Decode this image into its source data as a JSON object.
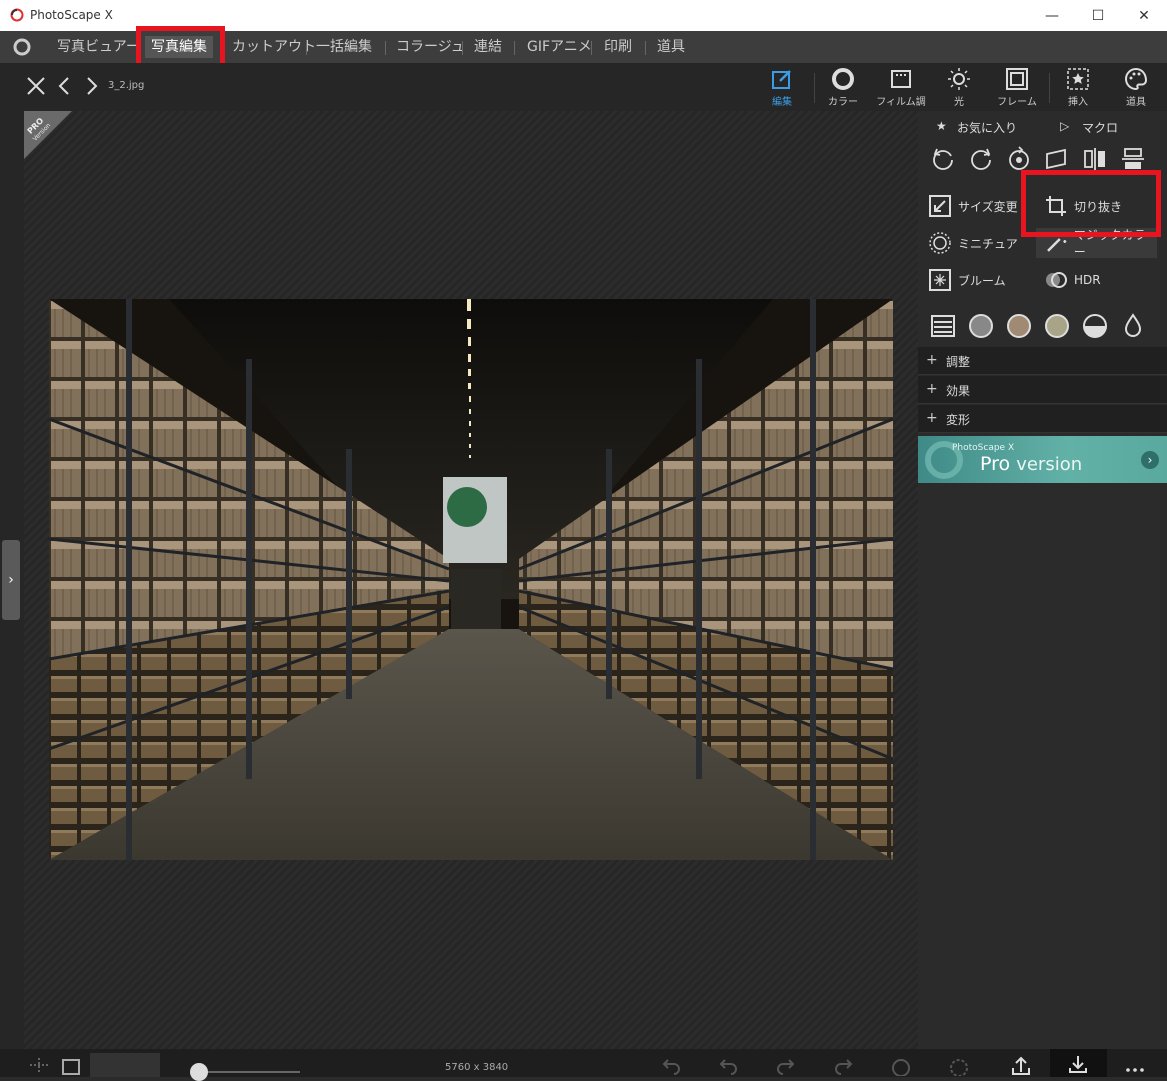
{
  "window": {
    "title": "PhotoScape X",
    "minimize": "—",
    "maximize": "☐",
    "close": "✕"
  },
  "menu": {
    "items": [
      {
        "label": "写真ビュアー"
      },
      {
        "label": "写真編集"
      },
      {
        "label": "カットアウト"
      },
      {
        "label": "一括編集"
      },
      {
        "label": "コラージュ"
      },
      {
        "label": "連結"
      },
      {
        "label": "GIFアニメ"
      },
      {
        "label": "印刷"
      },
      {
        "label": "道具"
      }
    ],
    "active": "写真編集"
  },
  "toolbar": {
    "filename": "3_2.jpg",
    "tools": [
      {
        "label": "編集",
        "icon": "edit-icon",
        "active": true
      },
      {
        "label": "カラー",
        "icon": "color-circle-icon"
      },
      {
        "label": "フィルム調",
        "icon": "film-icon"
      },
      {
        "label": "光",
        "icon": "light-sun-icon"
      },
      {
        "label": "フレーム",
        "icon": "frame-icon"
      },
      {
        "label": "挿入",
        "icon": "insert-star-icon"
      },
      {
        "label": "道具",
        "icon": "palette-icon"
      }
    ]
  },
  "canvas": {
    "ribbon_top": "PRO",
    "ribbon_bottom": "Version"
  },
  "sidebar": {
    "favorites": "お気に入り",
    "macro": "マクロ",
    "functions": {
      "resize": "サイズ変更",
      "crop": "切り抜き",
      "miniature": "ミニチュア",
      "magic_color": "マジックカラー",
      "bloom": "ブルーム",
      "hdr": "HDR"
    },
    "sections": [
      "調整",
      "効果",
      "変形"
    ],
    "pro_banner": {
      "small": "PhotoScape X",
      "pro": "Pro",
      "version": "version",
      "arrow": "›"
    }
  },
  "bottom": {
    "size_text": "5760 x 3840"
  },
  "colors": {
    "highlight": "#e8141f",
    "accent": "#3b9de6"
  }
}
